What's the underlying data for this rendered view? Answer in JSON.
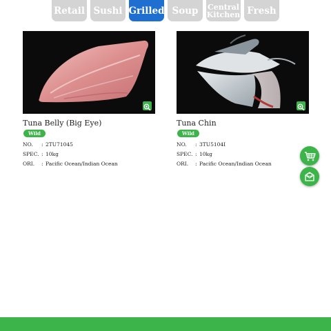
{
  "tabs": [
    {
      "label": "Retail",
      "active": false
    },
    {
      "label": "Sushi",
      "active": false
    },
    {
      "label": "Grilled",
      "active": true
    },
    {
      "label": "Soup",
      "active": false
    },
    {
      "label_line1": "Central",
      "label_line2": "Kitchen",
      "active": false
    },
    {
      "label": "Fresh",
      "active": false
    }
  ],
  "products": [
    {
      "name": "Tuna Belly (Big Eye)",
      "badge": "Wild",
      "specs": [
        {
          "key": "NO.",
          "sep": ":",
          "value": "2TU71045"
        },
        {
          "key": "SPEC.",
          "sep": ":",
          "value": "10kg"
        },
        {
          "key": "ORI.",
          "sep": ":",
          "value": "Pacific Ocean/Indian Ocean"
        }
      ],
      "zoom_icon": "zoom-in-icon"
    },
    {
      "name": "Tuna Chin",
      "badge": "Wild",
      "specs": [
        {
          "key": "NO.",
          "sep": ":",
          "value": "3TU5104I"
        },
        {
          "key": "SPEC.",
          "sep": ":",
          "value": "10kg"
        },
        {
          "key": "ORI.",
          "sep": ":",
          "value": "Pacific Ocean/Indian Ocean"
        }
      ],
      "zoom_icon": "zoom-in-icon"
    }
  ],
  "floating_buttons": [
    {
      "icon": "shopping-cart-icon"
    },
    {
      "icon": "mail-icon"
    }
  ],
  "colors": {
    "accent_green": "#3cb44a",
    "active_tab_blue": "#1f6fd1",
    "inactive_tab_gray": "#d4d4d4"
  }
}
